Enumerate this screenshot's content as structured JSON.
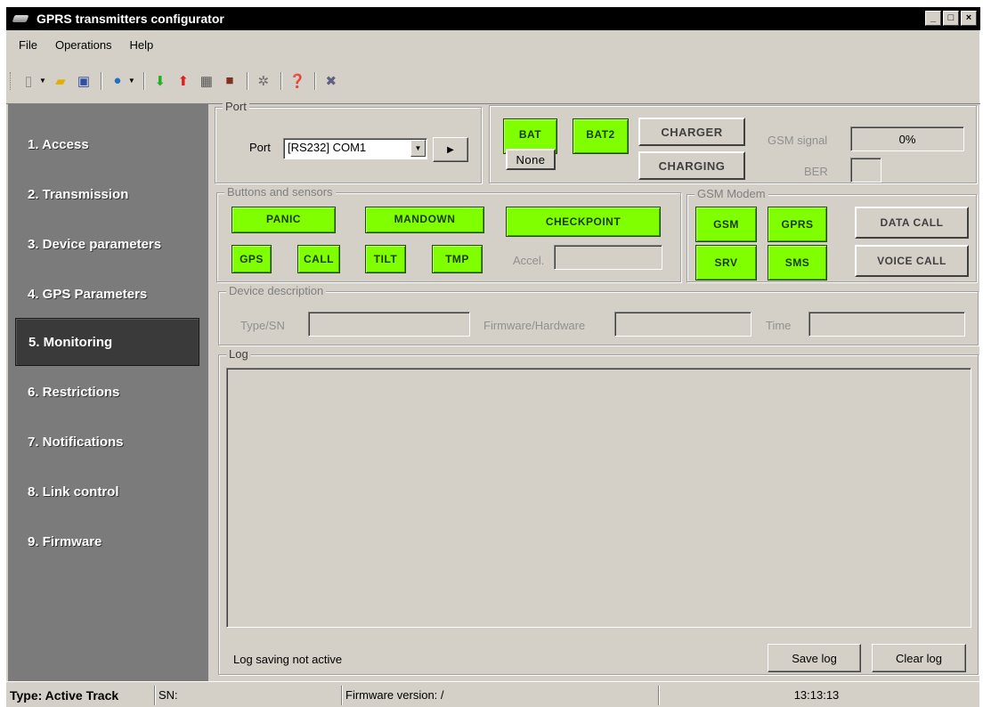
{
  "window": {
    "title": "GPRS transmitters configurator"
  },
  "menu": [
    "File",
    "Operations",
    "Help"
  ],
  "toolbar": {
    "icons": [
      "new-icon",
      "open-folder-icon",
      "save-icon",
      "globe-icon",
      "download-arrow-icon",
      "upload-arrow-icon",
      "calendar-icon",
      "book-icon",
      "settings-gear-icon",
      "help-icon",
      "exit-icon"
    ]
  },
  "sidebar": {
    "items": [
      "1. Access",
      "2. Transmission",
      "3. Device parameters",
      "4. GPS Parameters",
      "5. Monitoring",
      "6. Restrictions",
      "7. Notifications",
      "8. Link control",
      "9. Firmware"
    ],
    "active_index": 4
  },
  "port": {
    "group_title": "Port",
    "label": "Port",
    "selected": "[RS232] COM1"
  },
  "status": {
    "bat": "BAT",
    "bat2": "BAT2",
    "none": "None",
    "charger": "CHARGER",
    "charging": "CHARGING",
    "gsm_signal_label": "GSM signal",
    "gsm_signal_value": "0%",
    "ber_label": "BER",
    "ber_value": ""
  },
  "sensors": {
    "group_title": "Buttons and sensors",
    "panic": "PANIC",
    "mandown": "MANDOWN",
    "checkpoint": "CHECKPOINT",
    "gps": "GPS",
    "call": "CALL",
    "tilt": "TILT",
    "tmp": "TMP",
    "accel_label": "Accel.",
    "accel_value": ""
  },
  "modem": {
    "group_title": "GSM Modem",
    "gsm": "GSM",
    "gprs": "GPRS",
    "srv": "SRV",
    "sms": "SMS",
    "data_call": "DATA CALL",
    "voice_call": "VOICE CALL"
  },
  "device": {
    "group_title": "Device description",
    "type_label": "Type/SN",
    "type_value": "",
    "firmware_label": "Firmware/Hardware",
    "firmware_value": "",
    "time_label": "Time",
    "time_value": ""
  },
  "log": {
    "group_title": "Log",
    "status_text": "Log saving not active",
    "save_label": "Save log",
    "clear_label": "Clear log"
  },
  "statusbar": {
    "type": "Type: Active Track",
    "sn": "SN:",
    "firmware": "Firmware version: /",
    "time": "13:13:13"
  },
  "colors": {
    "indicator_on": "#80ff00",
    "sidebar_bg": "#7b7b7b",
    "sidebar_active": "#3a3a3a",
    "window_bg": "#d4d0c8"
  }
}
